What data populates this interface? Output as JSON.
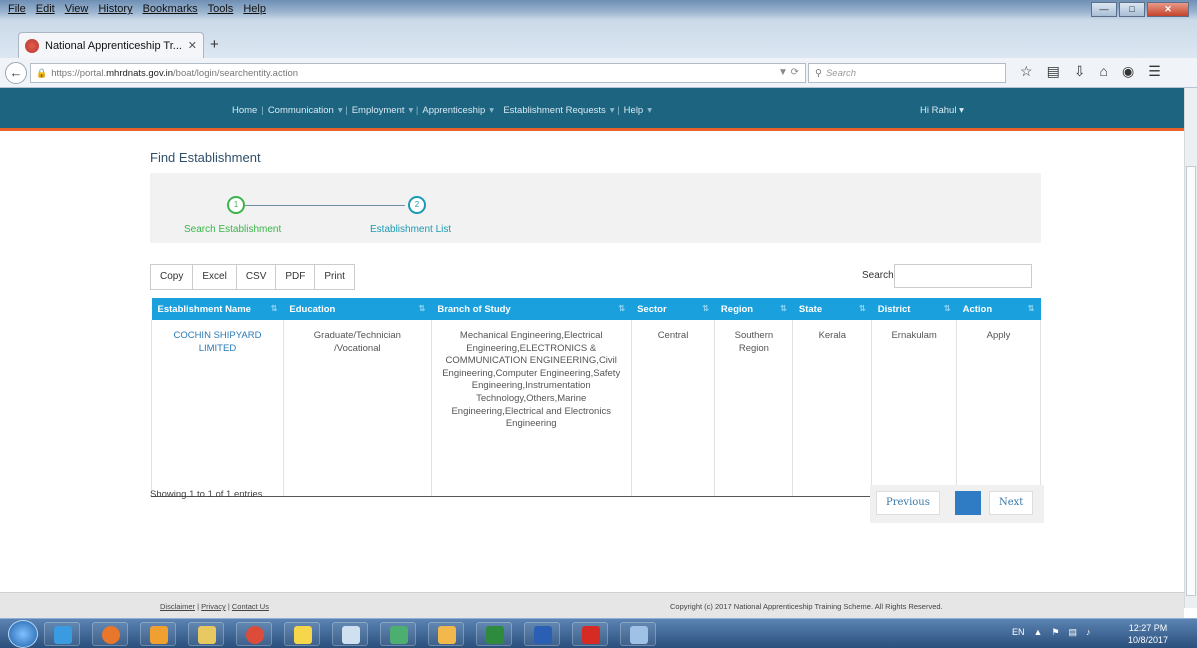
{
  "browser": {
    "menu": [
      "File",
      "Edit",
      "View",
      "History",
      "Bookmarks",
      "Tools",
      "Help"
    ],
    "tab_title": "National Apprenticeship Tr...",
    "url_prefix": "https://portal.",
    "url_domain": "mhrdnats.gov.in",
    "url_path": "/boat/login/searchentity.action",
    "search_placeholder": "Search"
  },
  "site_nav": {
    "items": [
      "Home",
      "Communication",
      "Employment",
      "Apprenticeship",
      "Establishment Requests",
      "Help"
    ],
    "greeting": "Hi Rahul"
  },
  "page": {
    "title": "Find Establishment",
    "steps": [
      {
        "number": "1",
        "label": "Search Establishment"
      },
      {
        "number": "2",
        "label": "Establishment List"
      }
    ]
  },
  "toolbar": {
    "buttons": [
      "Copy",
      "Excel",
      "CSV",
      "PDF",
      "Print"
    ],
    "search_label": "Search:"
  },
  "table": {
    "columns": [
      "Establishment Name",
      "Education",
      "Branch of Study",
      "Sector",
      "Region",
      "State",
      "District",
      "Action"
    ],
    "rows": [
      {
        "name": "COCHIN SHIPYARD LIMITED",
        "education": "Graduate/Technician /Vocational",
        "branch": "Mechanical Engineering,Electrical Engineering,ELECTRONICS & COMMUNICATION ENGINEERING,Civil Engineering,Computer Engineering,Safety Engineering,Instrumentation Technology,Others,Marine Engineering,Electrical and Electronics Engineering",
        "sector": "Central",
        "region": "Southern Region",
        "state": "Kerala",
        "district": "Ernakulam",
        "action": "Apply"
      }
    ],
    "info": "Showing 1 to 1 of 1 entries"
  },
  "pagination": {
    "previous": "Previous",
    "next": "Next"
  },
  "footer": {
    "links": [
      "Disclaimer",
      "Privacy",
      "Contact Us"
    ],
    "copyright": "Copyright (c) 2017 National Apprenticeship Training Scheme. All Rights Reserved."
  },
  "taskbar": {
    "language": "EN",
    "time": "12:27 PM",
    "date": "10/8/2017"
  },
  "colors": {
    "header_bg": "#1c6480",
    "table_header": "#1aa0dd",
    "step_done": "#3bb44a",
    "step_active": "#1a9ab3"
  }
}
